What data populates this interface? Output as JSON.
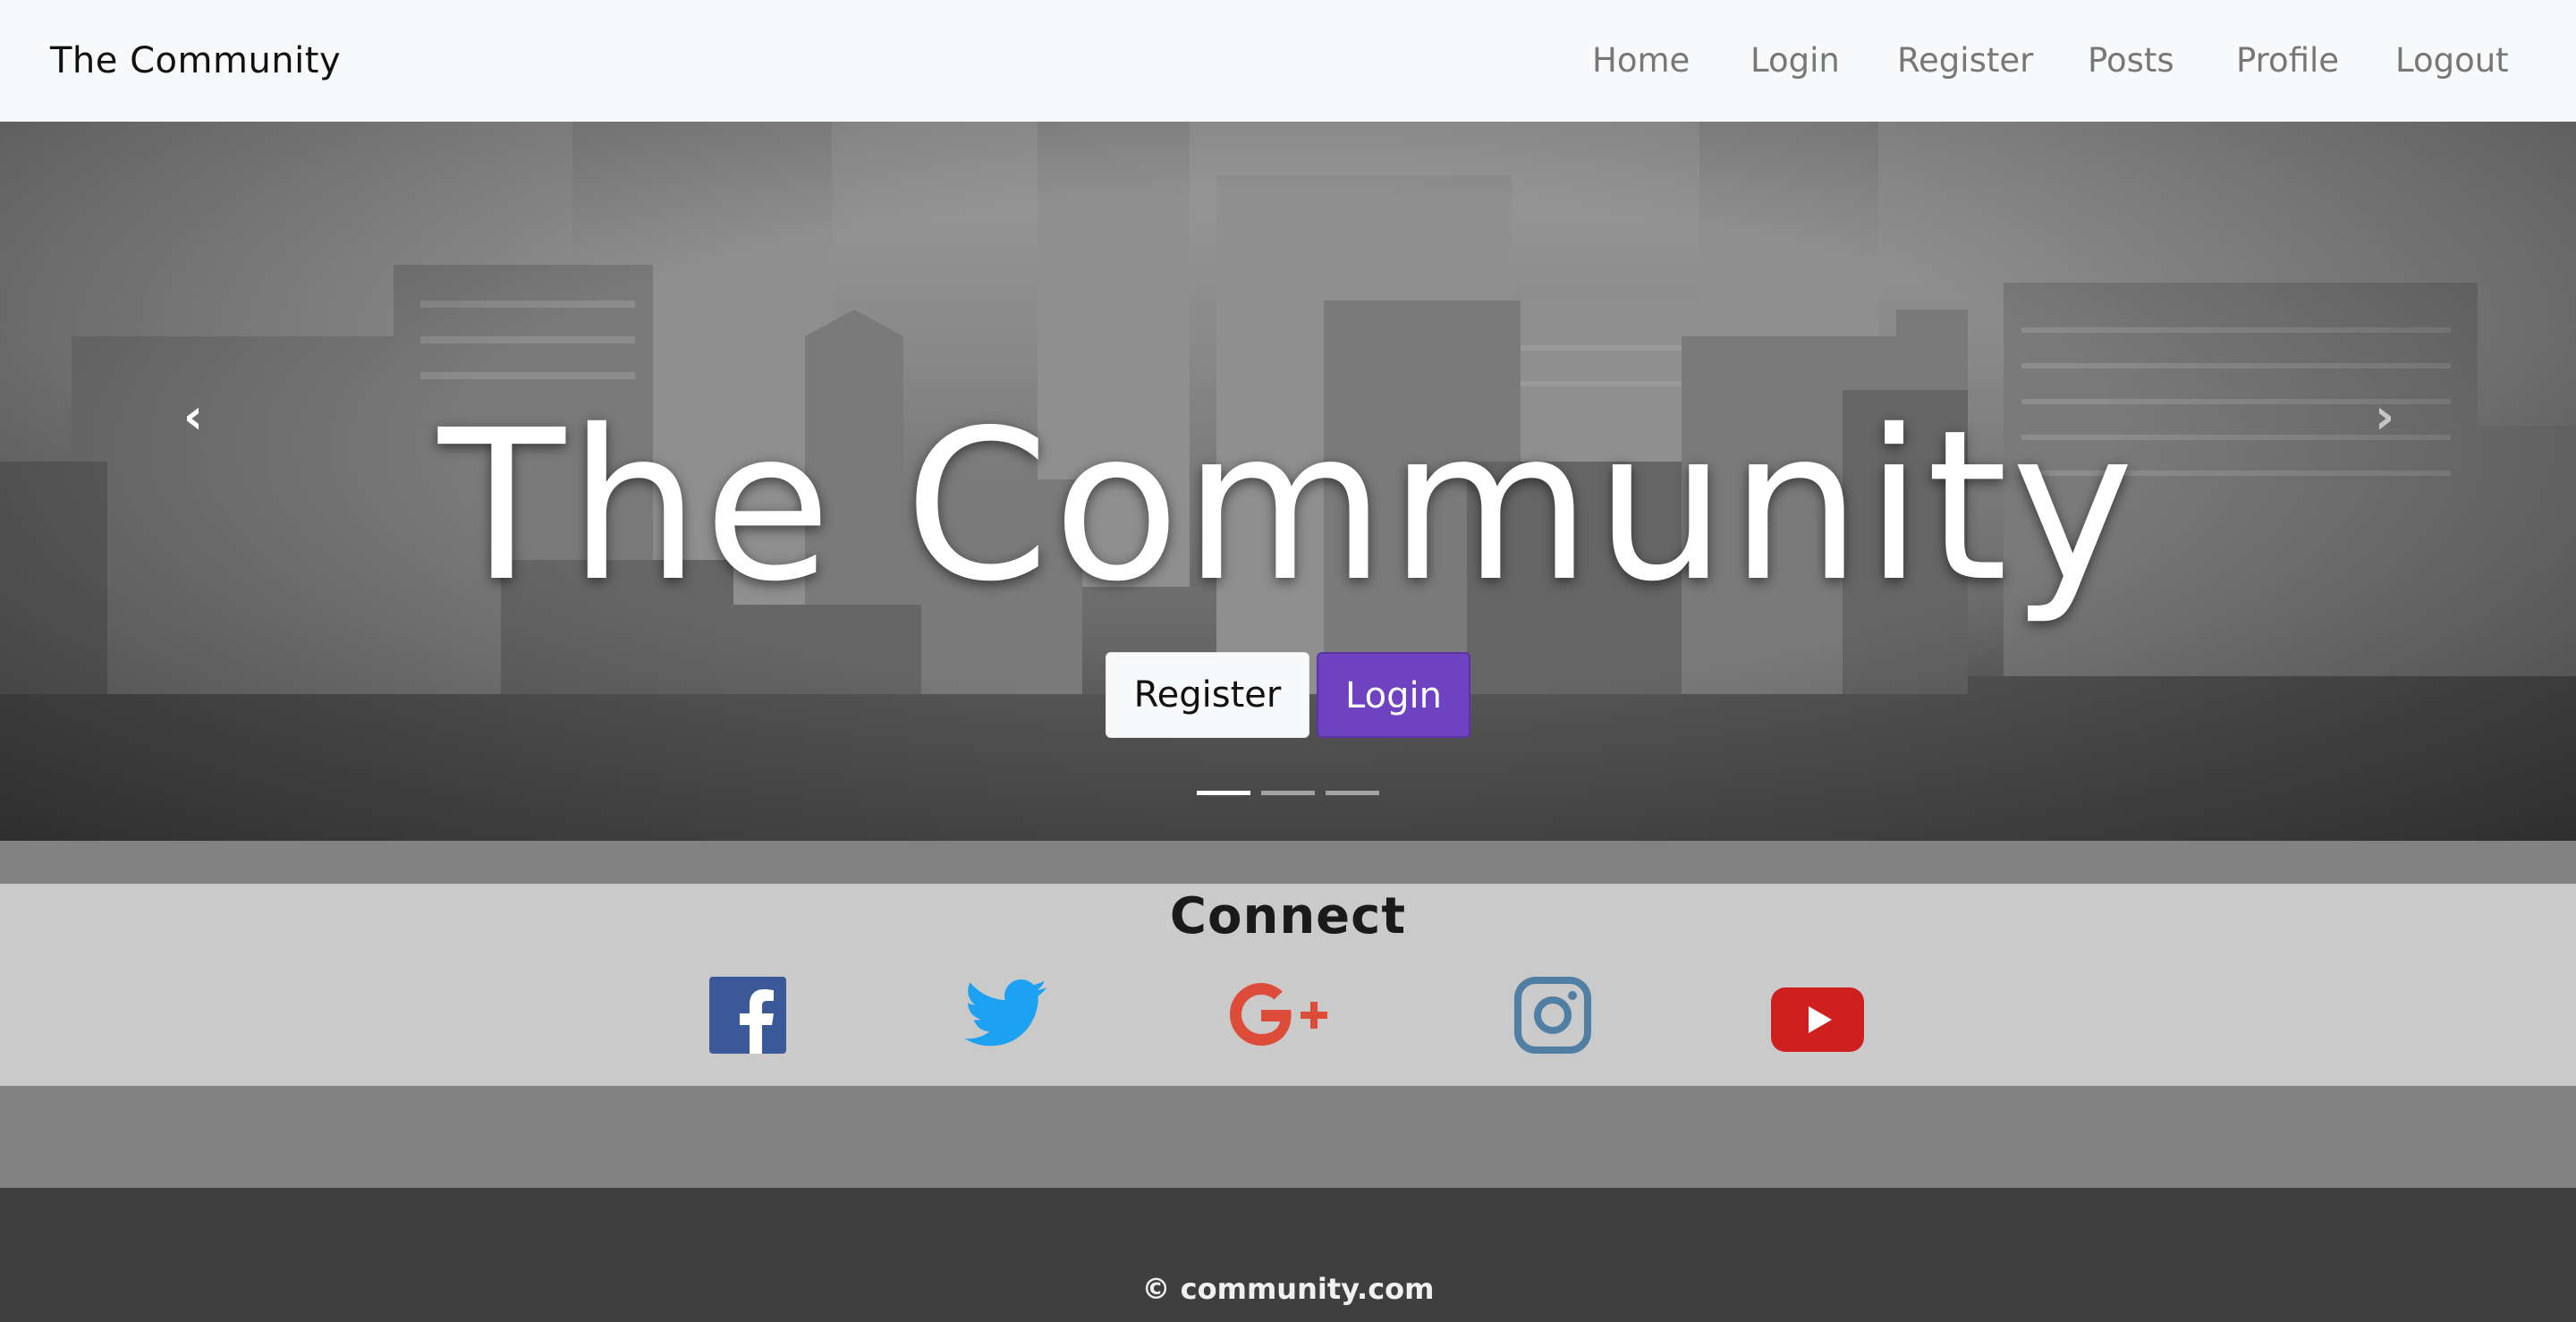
{
  "navbar": {
    "brand": "The Community",
    "links": {
      "home": "Home",
      "login": "Login",
      "register": "Register",
      "posts": "Posts",
      "profile": "Profile",
      "logout": "Logout"
    }
  },
  "hero": {
    "title": "The Community",
    "register_label": "Register",
    "login_label": "Login",
    "prev_icon": "chevron-left-icon",
    "next_icon": "chevron-right-icon",
    "slides": 3,
    "active_slide": 1
  },
  "connect": {
    "title": "Connect",
    "icons": [
      "facebook-icon",
      "twitter-icon",
      "google-plus-icon",
      "instagram-icon",
      "youtube-icon"
    ]
  },
  "footer": {
    "copyright": "© community.com"
  },
  "colors": {
    "accent": "#6f42c1",
    "facebook": "#3b5998",
    "twitter": "#1da1f2",
    "google_plus": "#dd4b39",
    "instagram": "#517fa4",
    "youtube": "#cd201f"
  }
}
